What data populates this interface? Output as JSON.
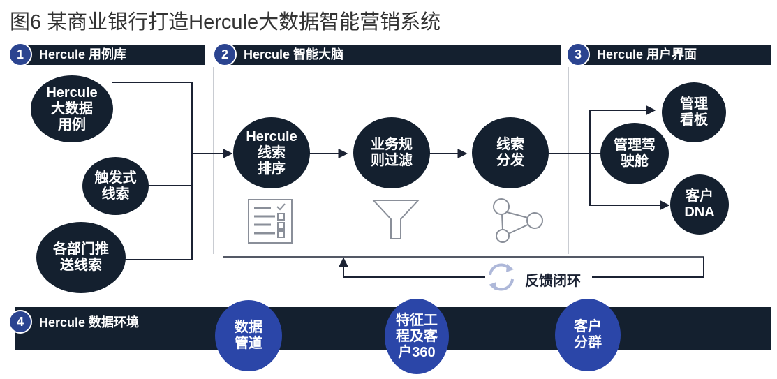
{
  "title": "图6 某商业银行打造Hercule大数据智能营销系统",
  "sections": [
    {
      "number": "1",
      "label": "Hercule 用例库"
    },
    {
      "number": "2",
      "label": "Hercule 智能大脑"
    },
    {
      "number": "3",
      "label": "Hercule 用户界面"
    },
    {
      "number": "4",
      "label": "Hercule 数据环境"
    }
  ],
  "use_cases": [
    "Hercule\n大数据\n用例",
    "触发式\n线索",
    "各部门推\n送线索"
  ],
  "brain_steps": [
    "Hercule\n线索\n排序",
    "业务规\n则过滤",
    "线索\n分发"
  ],
  "user_interface": {
    "center": "管理驾\n驶舱",
    "top": "管理\n看板",
    "bottom": "客户\nDNA"
  },
  "feedback_label": "反馈闭环",
  "data_env": [
    "数据\n管道",
    "特征工\n程及客\n户360",
    "客户\n分群"
  ],
  "colors": {
    "dark_navy": "#14202f",
    "badge_blue": "#2b4490",
    "circle_blue": "#2b46a8"
  },
  "icons": [
    "checklist-icon",
    "funnel-icon",
    "network-icon",
    "refresh-icon"
  ]
}
